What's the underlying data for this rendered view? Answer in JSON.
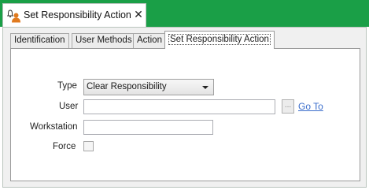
{
  "window": {
    "title": "Set Responsibility Action",
    "close_glyph": "✕",
    "tab_icon": "user-bell-icon"
  },
  "tabs": [
    {
      "label": "Identification",
      "active": false
    },
    {
      "label": "User Methods",
      "active": false
    },
    {
      "label": "Action",
      "active": false
    },
    {
      "label": "Set Responsibility Action",
      "active": true
    }
  ],
  "form": {
    "type_label": "Type",
    "type_value": "Clear Responsibility",
    "user_label": "User",
    "user_value": "",
    "ellipsis_label": "...",
    "goto_label": "Go To",
    "workstation_label": "Workstation",
    "workstation_value": "",
    "force_label": "Force",
    "force_checked": false
  },
  "colors": {
    "header_green": "#1a9f47",
    "link_blue": "#3b6ecc",
    "icon_orange": "#e07a1f"
  }
}
